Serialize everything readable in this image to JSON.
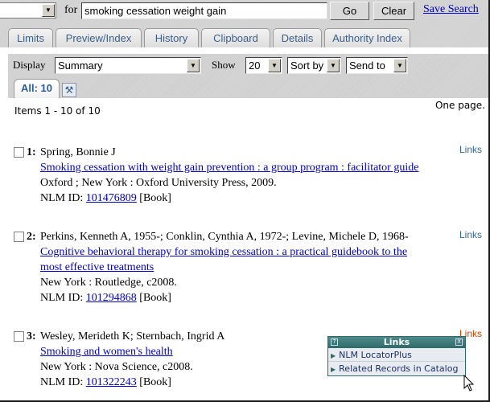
{
  "search": {
    "db_select_value": "",
    "for_label": "for",
    "query": "smoking cessation weight gain",
    "go_label": "Go",
    "clear_label": "Clear",
    "save_search_label": "Save Search"
  },
  "tabs": [
    {
      "label": "Limits"
    },
    {
      "label": "Preview/Index"
    },
    {
      "label": "History"
    },
    {
      "label": "Clipboard"
    },
    {
      "label": "Details"
    },
    {
      "label": "Authority Index"
    }
  ],
  "display_bar": {
    "display_label": "Display",
    "display_value": "Summary",
    "show_label": "Show",
    "show_value": "20",
    "sort_value": "Sort by",
    "send_value": "Send to",
    "all_tab_label": "All: 10",
    "tool_icon": "tools-icon"
  },
  "results_info": {
    "items_count": "Items 1 - 10 of 10",
    "pages": "One page."
  },
  "results": [
    {
      "number": "1:",
      "authors": "Spring, Bonnie J",
      "title": "Smoking cessation with weight gain prevention : a group program : facilitator guide",
      "publication": "Oxford ; New York : Oxford University Press, 2009.",
      "nlm_id_label": "NLM ID:",
      "nlm_id": "101476809",
      "type": "[Book]",
      "links_label": "Links"
    },
    {
      "number": "2:",
      "authors": "Perkins, Kenneth A, 1955-; Conklin, Cynthia A, 1972-; Levine, Michele D, 1968-",
      "title_line1": "Cognitive behavioral therapy for smoking cessation : a practical guidebook to the",
      "title_line2": "most effective treatments",
      "publication": "New York : Routledge, c2008.",
      "nlm_id_label": "NLM ID:",
      "nlm_id": "101294868",
      "type": "[Book]",
      "links_label": "Links"
    },
    {
      "number": "3:",
      "authors": "Wesley, Merideth K; Sternbach, Ingrid A",
      "title": "Smoking and women's health",
      "publication": "New York : Nova Science, c2008.",
      "nlm_id_label": "NLM ID:",
      "nlm_id": "101322243",
      "type": "[Book]",
      "links_label": "Links"
    }
  ],
  "links_popup": {
    "title": "Links",
    "help_glyph": "?",
    "close_glyph": "X",
    "items": [
      {
        "label": "NLM LocatorPlus"
      },
      {
        "label": "Related Records in Catalog"
      }
    ]
  },
  "colors": {
    "link": "#0000cc",
    "tab_text": "#3b5f8c",
    "links_text": "#336699",
    "links_active": "#cc4400",
    "popup_header": "#2f6b6b"
  }
}
